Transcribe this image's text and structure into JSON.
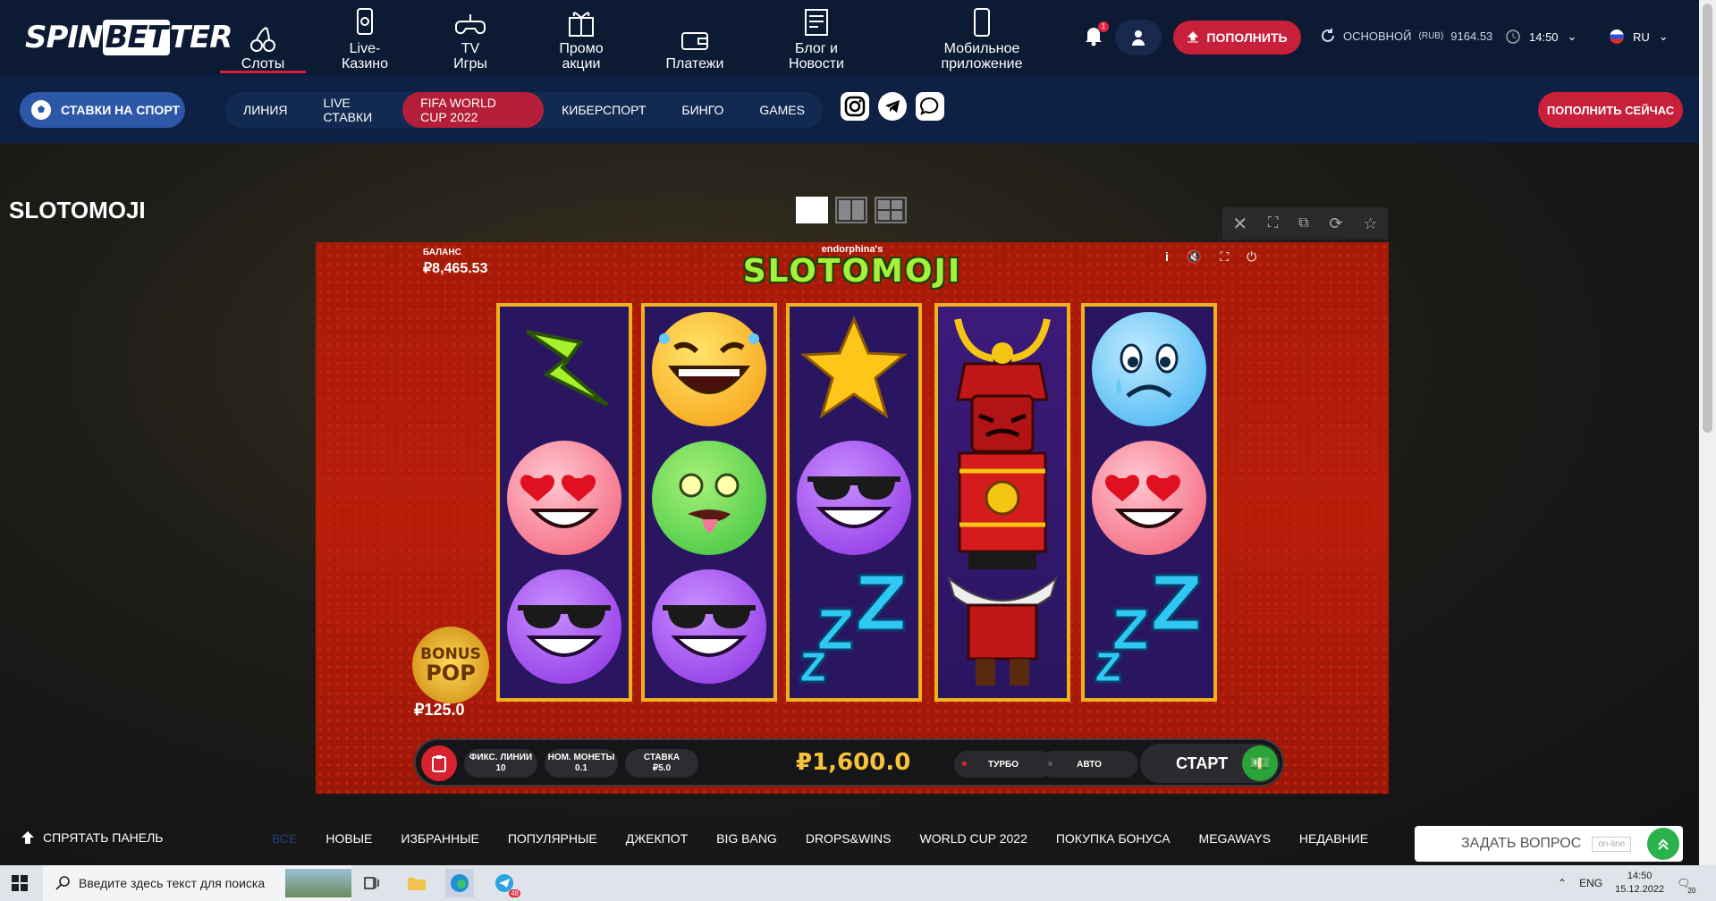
{
  "brand": {
    "logo": "SPINBETTER",
    "logo_a": "SPIN",
    "logo_b": "BET",
    "logo_c": "TER"
  },
  "nav": [
    {
      "label": "Слоты",
      "icon": "cherry-icon",
      "active": true
    },
    {
      "label": "Live-\nКазино",
      "icon": "live-casino-icon"
    },
    {
      "label": "TV\nИгры",
      "icon": "gamepad-icon"
    },
    {
      "label": "Промо\nакции",
      "icon": "gift-icon"
    },
    {
      "label": "Платежи",
      "icon": "wallet-icon"
    },
    {
      "label": "Блог и\nНовости",
      "icon": "news-icon"
    },
    {
      "label": "Мобильное\nприложение",
      "icon": "phone-icon"
    }
  ],
  "header": {
    "notifications": "1",
    "deposit_label": "ПОПОЛНИТЬ",
    "account_label": "ОСНОВНОЙ",
    "currency": "(RUB)",
    "balance": "9164.53",
    "time": "14:50",
    "lang": "RU"
  },
  "subbar": {
    "sport_label": "СТАВКИ НА СПОРТ",
    "tabs": [
      "ЛИНИЯ",
      "LIVE СТАВКИ",
      "FIFA WORLD CUP 2022",
      "КИБЕРСПОРТ",
      "БИНГО",
      "GAMES"
    ],
    "active_tab": 2,
    "deposit_now": "ПОПОЛНИТЬ СЕЙЧАС"
  },
  "game": {
    "title": "SLOTOMOJI",
    "balance_label": "БАЛАНС",
    "balance_value": "₽8,465.53",
    "provider": "endorphina's",
    "name": "SLOTOMOJI",
    "bonus_top": "BONUS",
    "bonus_bottom": "POP",
    "bonus_value": "₽125.0",
    "reels": [
      [
        "lightning-symbol",
        "heart-eyes-emoji",
        "sunglasses-emoji"
      ],
      [
        "laughing-emoji",
        "sick-emoji",
        "sunglasses-emoji"
      ],
      [
        "star-symbol",
        "sunglasses-emoji",
        "zzz-symbol"
      ],
      [
        "samurai-wild",
        "samurai-wild",
        "samurai-wild"
      ],
      [
        "sad-emoji",
        "heart-eyes-emoji",
        "zzz-symbol"
      ]
    ],
    "controls": {
      "lines_label": "ФИКС. ЛИНИИ",
      "lines_value": "10",
      "coin_label": "НОМ. МОНЕТЫ",
      "coin_value": "0.1",
      "stake_label": "СТАВКА",
      "stake_value": "₽5.0",
      "total_bet": "₽1,600.0",
      "turbo": "ТУРБО",
      "auto": "АВТО",
      "start": "СТАРТ"
    }
  },
  "bottom": {
    "hide_panel": "СПРЯТАТЬ ПАНЕЛЬ",
    "categories": [
      "ВСЕ",
      "НОВЫЕ",
      "ИЗБРАННЫЕ",
      "ПОПУЛЯРНЫЕ",
      "ДЖЕКПОТ",
      "BIG BANG",
      "DROPS&WINS",
      "WORLD CUP 2022",
      "ПОКУПКА БОНУСА",
      "MEGAWAYS",
      "НЕДАВНИЕ"
    ],
    "ask_question": "ЗАДАТЬ ВОПРОС",
    "online": "on-line"
  },
  "taskbar": {
    "search_placeholder": "Введите здесь текст для поиска",
    "telegram_badge": "48",
    "lang": "ENG",
    "time": "14:50",
    "date": "15.12.2022",
    "notif": "20"
  },
  "colors": {
    "accent": "#c8203a",
    "navy": "#0c1a33",
    "reel_border": "#f0b21a",
    "game_bg": "#b61e0a"
  }
}
